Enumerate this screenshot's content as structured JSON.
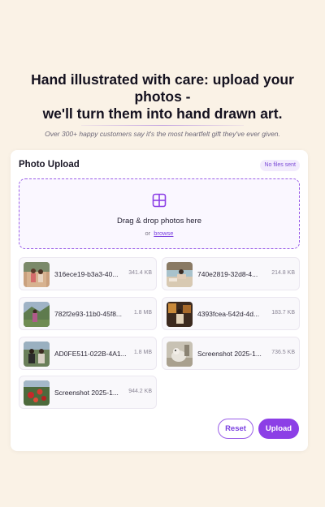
{
  "hero": {
    "title_line1": "Hand illustrated with care: upload your photos -",
    "title_line2": "we'll turn them into hand drawn art.",
    "subtitle": "Over 300+ happy customers say it's the most heartfelt gift they've ever given."
  },
  "upload": {
    "title": "Photo Upload",
    "status_badge": "No files sent",
    "dropzone": {
      "icon": "grid-icon",
      "title": "Drag & drop photos here",
      "or_text": "or",
      "browse_label": "browse"
    },
    "files": [
      {
        "name": "316ece19-b3a3-40...",
        "size": "341.4 KB",
        "thumb": "photo-thumbnail"
      },
      {
        "name": "740e2819-32d8-4...",
        "size": "214.8 KB",
        "thumb": "photo-thumbnail"
      },
      {
        "name": "782f2e93-11b0-45f8...",
        "size": "1.8 MB",
        "thumb": "photo-thumbnail"
      },
      {
        "name": "4393fcea-542d-4d...",
        "size": "183.7 KB",
        "thumb": "photo-thumbnail"
      },
      {
        "name": "AD0FE511-022B-4A1...",
        "size": "1.8 MB",
        "thumb": "photo-thumbnail"
      },
      {
        "name": "Screenshot 2025-1...",
        "size": "736.5 KB",
        "thumb": "photo-thumbnail"
      },
      {
        "name": "Screenshot 2025-1...",
        "size": "944.2 KB",
        "thumb": "photo-thumbnail"
      }
    ],
    "buttons": {
      "reset": "Reset",
      "upload": "Upload"
    }
  },
  "colors": {
    "background": "#faf2e6",
    "accent": "#8c3fe6",
    "badge_bg": "#f2ebfd"
  }
}
